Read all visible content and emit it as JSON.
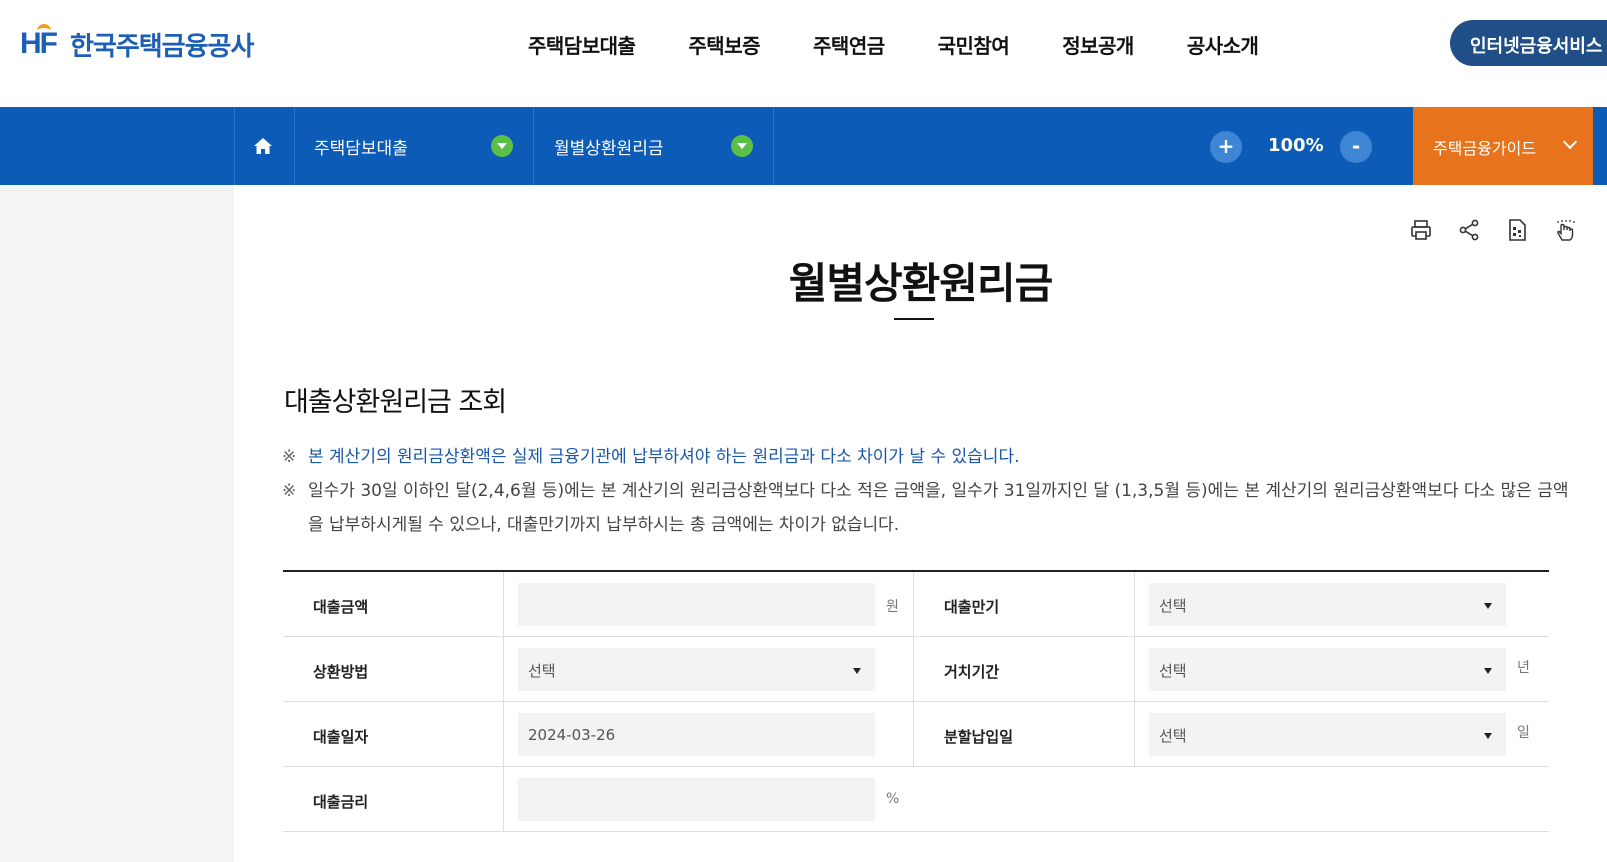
{
  "header": {
    "logo_mark": "HF",
    "logo_text": "한국주택금융공사",
    "gnb": [
      "주택담보대출",
      "주택보증",
      "주택연금",
      "국민참여",
      "정보공개",
      "공사소개"
    ],
    "internet_service": "인터넷금융서비스"
  },
  "navbar": {
    "crumbs": [
      "주택담보대출",
      "월별상환원리금"
    ],
    "zoom_in": "+",
    "zoom_level": "100%",
    "zoom_out": "-",
    "guide": "주택금융가이드"
  },
  "page": {
    "title": "월별상환원리금",
    "section_title": "대출상환원리금 조회",
    "note_mark": "※",
    "notes": [
      "본 계산기의 원리금상환액은 실제 금융기관에 납부하셔야 하는 원리금과 다소 차이가 날 수 있습니다.",
      "일수가 30일 이하인 달(2,4,6월 등)에는 본 계산기의 원리금상환액보다 다소 적은 금액을, 일수가 31일까지인 달 (1,3,5월 등)에는 본 계산기의 원리금상환액보다 다소 많은 금액을 납부하시게될 수 있으나, 대출만기까지 납부하시는 총 금액에는 차이가 없습니다."
    ]
  },
  "form": {
    "loan_amount": {
      "label": "대출금액",
      "value": "",
      "unit": "원"
    },
    "loan_term": {
      "label": "대출만기",
      "value": "선택"
    },
    "repay_method": {
      "label": "상환방법",
      "value": "선택"
    },
    "grace_period": {
      "label": "거치기간",
      "value": "선택",
      "unit": "년"
    },
    "loan_date": {
      "label": "대출일자",
      "value": "2024-03-26"
    },
    "payment_day": {
      "label": "분할납입일",
      "value": "선택",
      "unit": "일"
    },
    "interest_rate": {
      "label": "대출금리",
      "value": "",
      "unit": "%"
    }
  },
  "colors": {
    "brand": "#1c5fb4",
    "nav_bar": "#0b5bb7",
    "guide": "#e8731d",
    "toggle": "#5cc047"
  }
}
